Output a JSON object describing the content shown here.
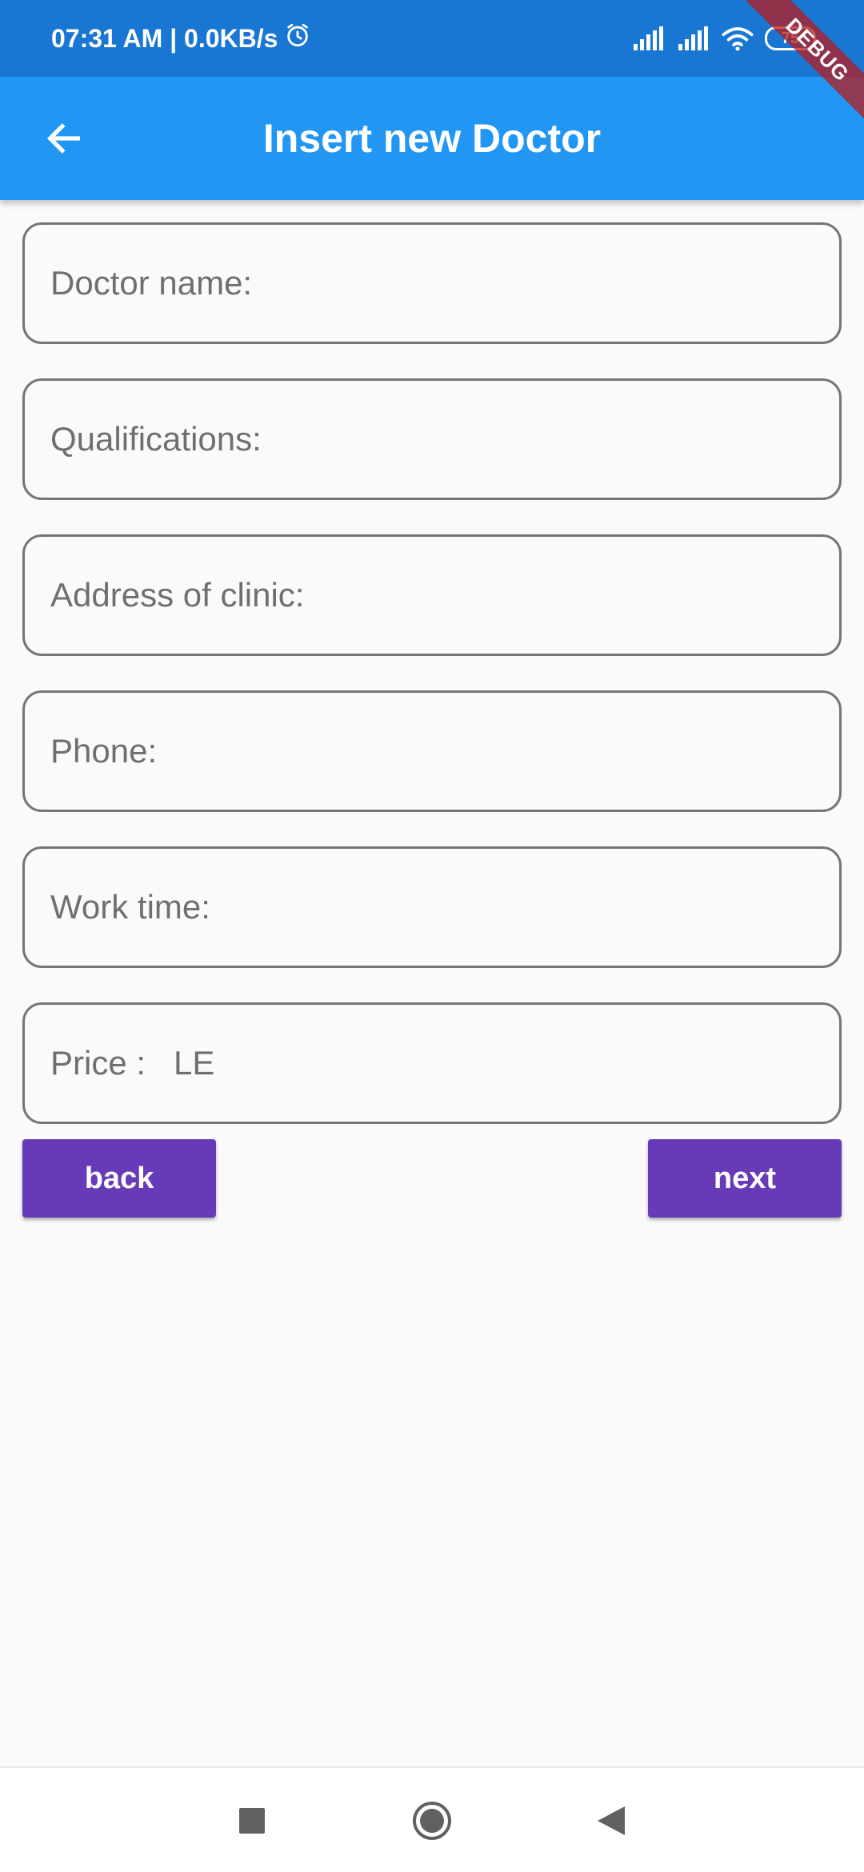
{
  "status_bar": {
    "time_speed": "07:31 AM | 0.0KB/s",
    "battery": "75",
    "debug_label": "DEBUG"
  },
  "app_bar": {
    "title": "Insert new Doctor"
  },
  "form": {
    "fields": [
      {
        "placeholder": "Doctor name:"
      },
      {
        "placeholder": "Qualifications:"
      },
      {
        "placeholder": "Address of clinic:"
      },
      {
        "placeholder": "Phone:"
      },
      {
        "placeholder": "Work time:"
      },
      {
        "placeholder": "Price :   LE"
      }
    ]
  },
  "buttons": {
    "back_label": "back",
    "next_label": "next"
  },
  "colors": {
    "status_bar": "#1976d2",
    "app_bar": "#2196f3",
    "button": "#673ab7",
    "background": "#fafafa"
  },
  "icons": {
    "back": "arrow-left-icon",
    "alarm": "alarm-clock-icon",
    "signal": "signal-icon",
    "wifi": "wifi-icon",
    "nav_recent": "square-icon",
    "nav_home": "circle-icon",
    "nav_back": "triangle-icon"
  }
}
